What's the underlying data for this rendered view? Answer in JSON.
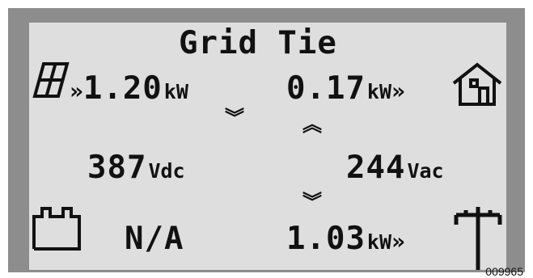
{
  "display": {
    "title": "Grid Tie",
    "pv_power": {
      "arrow": "»",
      "value": "1.20",
      "unit": "kW"
    },
    "home_power": {
      "value": "0.17",
      "unit": "kW",
      "arrow": "»"
    },
    "pv_down_chevron": "︾",
    "grid_up_chevron": "︽",
    "dc_voltage": {
      "value": "387",
      "unit": "Vdc"
    },
    "ac_voltage": {
      "value": "244",
      "unit": "Vac"
    },
    "grid_down_chevron": "︾",
    "battery_status": "N/A",
    "grid_power": {
      "value": "1.03",
      "unit": "kW",
      "arrow": "»"
    }
  },
  "figure_number": "009965",
  "icons": [
    "solar-panel-icon",
    "house-icon",
    "battery-icon",
    "utility-pole-icon"
  ]
}
